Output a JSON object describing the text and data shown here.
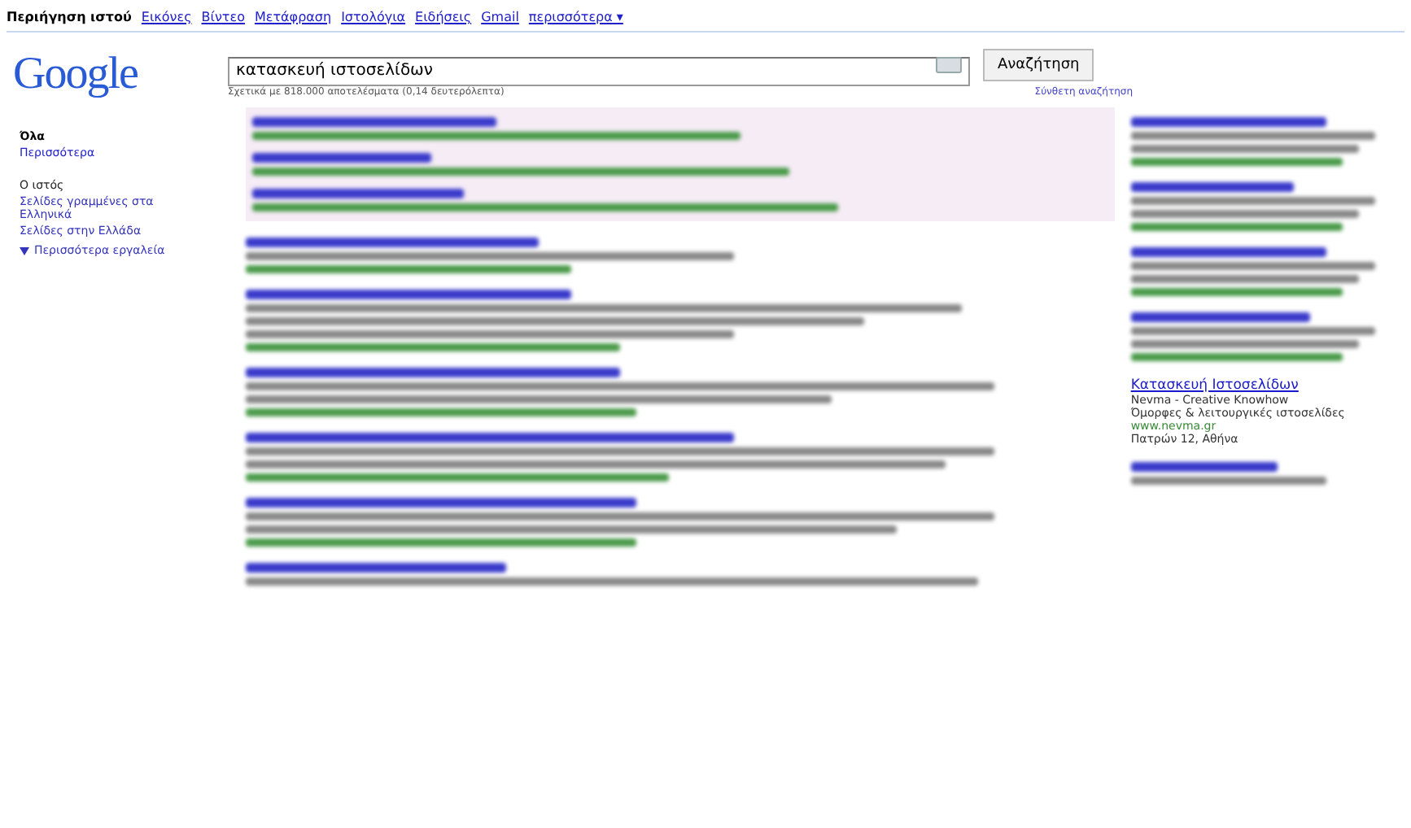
{
  "top_nav": [
    {
      "label": "Περιήγηση ιστού",
      "selected": true
    },
    {
      "label": "Εικόνες",
      "selected": false
    },
    {
      "label": "Βίντεο",
      "selected": false
    },
    {
      "label": "Μετάφραση",
      "selected": false
    },
    {
      "label": "Ιστολόγια",
      "selected": false
    },
    {
      "label": "Ειδήσεις",
      "selected": false
    },
    {
      "label": "Gmail",
      "selected": false
    },
    {
      "label": "περισσότερα ▾",
      "selected": false
    }
  ],
  "logo": "Google",
  "search": {
    "value": "κατασκευή ιστοσελίδων",
    "button": "Αναζήτηση",
    "advanced_link": "Σύνθετη αναζήτηση",
    "stats": "Σχετικά με 818.000 αποτελέσματα (0,14 δευτερόλεπτα)"
  },
  "sidebar": {
    "items": [
      {
        "label": "Όλα",
        "selected": true
      },
      {
        "label": "Περισσότερα",
        "selected": false
      }
    ],
    "heading": "Ο ιστός",
    "links": [
      "Σελίδες γραμμένες στα Ελληνικά",
      "Σελίδες στην Ελλάδα"
    ],
    "more_tools": "Περισσότερα εργαλεία"
  },
  "right_ad": {
    "title": "Κατασκευή Ιστοσελίδων",
    "line_1": "Nevma - Creative Knowhow",
    "line_2": "Όμορφες & λειτουργικές ιστοσελίδες",
    "url": "www.nevma.gr",
    "address": "Πατρών 12, Αθήνα"
  }
}
